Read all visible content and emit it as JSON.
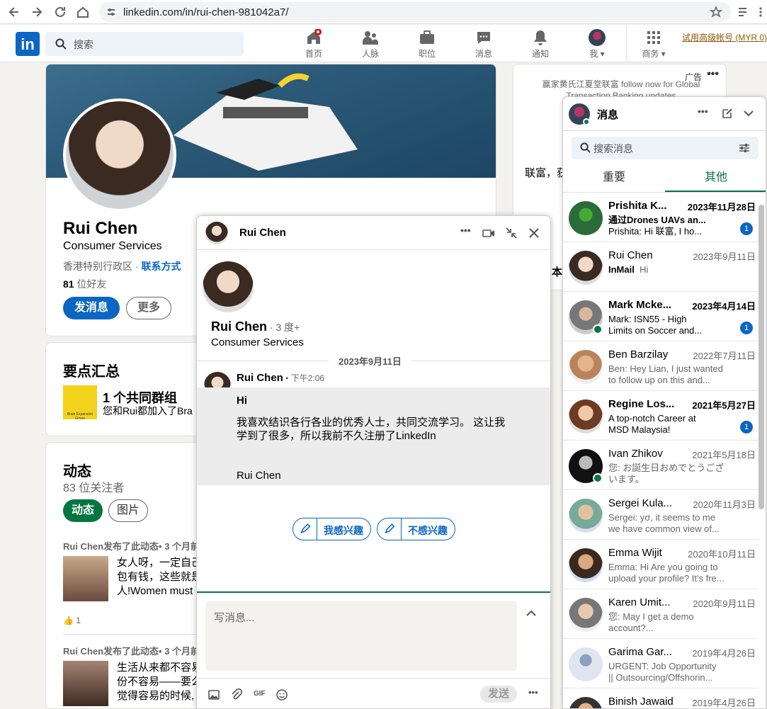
{
  "browser": {
    "url": "linkedin.com/in/rui-chen-981042a7/"
  },
  "nav": {
    "search_placeholder": "搜索",
    "items": [
      {
        "label": "首页",
        "icon": "home-icon"
      },
      {
        "label": "人脉",
        "icon": "network-icon"
      },
      {
        "label": "职位",
        "icon": "jobs-icon"
      },
      {
        "label": "消息",
        "icon": "messaging-icon"
      },
      {
        "label": "通知",
        "icon": "bell-icon"
      },
      {
        "label": "我",
        "icon": "me-avatar"
      },
      {
        "label": "商务",
        "icon": "grid-icon"
      }
    ],
    "premium": "试用高级帐号 (MYR 0)"
  },
  "profile": {
    "name": "Rui Chen",
    "headline": "Consumer Services",
    "location": "香港特别行政区 · ",
    "contact": "联系方式",
    "connections_count": "81",
    "connections_suffix": " 位好友",
    "message_btn": "发消息",
    "more_btn": "更多"
  },
  "highlights": {
    "title": "要点汇总",
    "group_title": "1 个共同群组",
    "group_desc": "您和Rui都加入了Bra",
    "group_logo_text": "Brain Expansion Group"
  },
  "activity": {
    "title": "动态",
    "followers": "83 位关注者",
    "tab_active": "动态",
    "tab_images": "图片",
    "posts": [
      {
        "meta": "Rui Chen发布了此动态• 3 个月前",
        "text1": "女人呀，一定自己",
        "text2": "包有钱，这些就是",
        "text3": "人!Women must",
        "likes": "1"
      },
      {
        "meta": "Rui Chen发布了此动态• 3 个月前",
        "text1": "生活从来都不容易",
        "text2": "份不容易——要么",
        "text3": "觉得容易的时候,"
      }
    ]
  },
  "ad": {
    "label": "广告",
    "text": "赢家黄氏江夏堂联富 follow now for Global Transaction Banking updates",
    "partial1": "联富，获",
    "partial2": "本"
  },
  "messaging": {
    "title": "消息",
    "search_placeholder": "搜索消息",
    "tabs": [
      "重要",
      "其他"
    ],
    "conversations": [
      {
        "name": "Prishita K...",
        "date": "2023年11月28日",
        "preview": "通过Drones UAVs an...",
        "preview2": "Prishita: Hi 联富, I ho...",
        "badge": "1",
        "unread": true
      },
      {
        "name": "Rui Chen",
        "date": "2023年9月11日",
        "preview": "InMail",
        "preview2": "Hi",
        "unread": false
      },
      {
        "name": "Mark Mcke...",
        "date": "2023年4月14日",
        "preview": "Mark: ISN55 - High",
        "preview2": "Limits on Soccer and...",
        "badge": "1",
        "unread": true,
        "online": true
      },
      {
        "name": "Ben Barzilay",
        "date": "2022年7月11日",
        "preview": "Ben: Hey Lian, I just wanted",
        "preview2": "to follow up on this and...",
        "unread": false
      },
      {
        "name": "Regine Los...",
        "date": "2021年5月27日",
        "preview": "A top-notch Career at",
        "preview2": "MSD Malaysia!",
        "badge": "1",
        "unread": true
      },
      {
        "name": "Ivan Zhikov",
        "date": "2021年5月18日",
        "preview": "您: お誕生日おめでとうござ",
        "preview2": "います。",
        "unread": false,
        "online": true
      },
      {
        "name": "Sergei Kula...",
        "date": "2020年11月3日",
        "preview": "Sergei: yσ, it seems to me",
        "preview2": "we have common view of...",
        "unread": false
      },
      {
        "name": "Emma Wijit",
        "date": "2020年10月11日",
        "preview": "Emma: Hi Are you going to",
        "preview2": "upload your profile? It's fre...",
        "unread": false
      },
      {
        "name": "Karen Umit...",
        "date": "2020年9月11日",
        "preview": "您: May I get a demo",
        "preview2": "account?...",
        "unread": false
      },
      {
        "name": "Garima Gar...",
        "date": "2019年4月26日",
        "preview": "URGENT: Job Opportunity",
        "preview2": "|| Outsourcing/Offshorin...",
        "unread": false
      },
      {
        "name": "Binish Jawaid",
        "date": "2019年4月26日",
        "preview": "",
        "preview2": "",
        "unread": false
      }
    ]
  },
  "chat": {
    "title": "Rui Chen",
    "profile_name": "Rui Chen",
    "degree": " · 3 度+",
    "headline": "Consumer Services",
    "date_divider": "2023年9月11日",
    "sender": "Rui Chen",
    "time": " • 下午2:06",
    "msg_subject": "Hi",
    "msg_line1": "我喜欢结识各行各业的优秀人士，共同交流学习。 这让我",
    "msg_line2": "学到了很多，所以我前不久注册了LinkedIn",
    "msg_sign": "Rui Chen",
    "interested": "我感兴趣",
    "not_interested": "不感兴趣",
    "compose_placeholder": "写消息...",
    "send": "发送"
  }
}
